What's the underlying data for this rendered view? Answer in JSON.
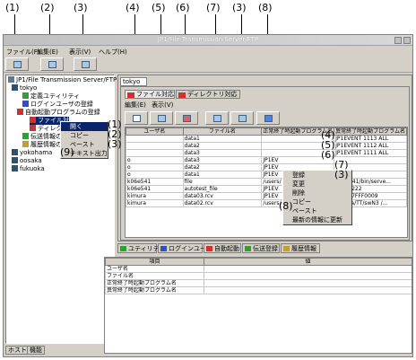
{
  "callouts": [
    "(1)",
    "(2)",
    "(3)",
    "(4)",
    "(5)",
    "(6)",
    "(7)",
    "(3)",
    "(8)"
  ],
  "window": {
    "title": "JP1/File Transmission Server/FTP"
  },
  "menu": {
    "file": "ファイル(F)",
    "edit": "編集(E)",
    "view": "表示(V)",
    "help": "ヘルプ(H)"
  },
  "tree": {
    "root": "JP1/File Transmission Server/FTP",
    "host1": "tokyo",
    "utility": "定義ユティリティ",
    "loginuser": "ログインユーザの登録",
    "autostart": "自動起動プログラムの登録",
    "file_item": "ファイル対",
    "dir_item": "ディレクト",
    "transfer": "伝送情報の登録",
    "history": "履歴情報の表",
    "host2": "yokohama",
    "host3": "oosaka",
    "host4": "fukuoka"
  },
  "ctx1": {
    "open": "開く",
    "copy": "コピー",
    "paste": "ペースト",
    "text_out": "テキスト出力"
  },
  "ctx1_callouts": [
    "(1)",
    "(2)",
    "(3)",
    "(9)"
  ],
  "bottom_tabs": {
    "host": "ホスト",
    "function": "機能"
  },
  "right": {
    "host_tab": "tokyo",
    "tabs": {
      "file": "ファイル対応",
      "dir": "ディレクトリ対応"
    },
    "menu": {
      "edit": "編集(E)",
      "view": "表示(V)"
    },
    "columns": [
      "ユーザ名",
      "ファイル名",
      "正常終了時起動プログラム名",
      "異常終了時起動プログラム名"
    ],
    "rows": [
      [
        "",
        "data1",
        "",
        "JP1EVENT 1113 ALL"
      ],
      [
        "",
        "data2",
        "",
        "JP1EVENT 1112 ALL"
      ],
      [
        "",
        "data3",
        "",
        "JP1EVENT 1111 ALL"
      ],
      [
        "o",
        "data3",
        "JP1EV",
        ""
      ],
      [
        "o",
        "data2",
        "JP1EV",
        ""
      ],
      [
        "o",
        "data1",
        "JP1EV",
        ""
      ],
      [
        "k06e541",
        "file",
        "/users/",
        "k06e541/bin/serve..."
      ],
      [
        "k06e541",
        "autotest_file",
        "JP1EV",
        "VENT 222"
      ],
      [
        "kimura",
        "data03.rcv",
        "JP1EV",
        "VENT 7FFF0009"
      ],
      [
        "kimura",
        "data02.rcv",
        "/users/",
        "kimura/TT/swN3 /..."
      ]
    ]
  },
  "ctx2": {
    "register": "登録",
    "change": "変更",
    "delete": "削除",
    "copy": "コピー",
    "paste": "ペースト",
    "refresh": "最新の情報に更新"
  },
  "ctx2_callouts": [
    "(4)",
    "(5)",
    "(6)",
    "(7)",
    "(3)",
    "(8)"
  ],
  "status_tabs": {
    "utility": "ユティリティ",
    "login": "ログインユーザ",
    "auto": "自動起動",
    "transfer": "伝送登録",
    "history": "履歴情報"
  },
  "detail": {
    "col_item": "項目",
    "col_value": "値",
    "rows": [
      "ユーザ名",
      "ファイル名",
      "正常終了時起動プログラム名",
      "異常終了時起動プログラム名"
    ]
  },
  "colors": {
    "selection": "#0a246a",
    "title_gradient": "#c0c0c0",
    "red_icon": "#d03030",
    "green_icon": "#30a030"
  }
}
